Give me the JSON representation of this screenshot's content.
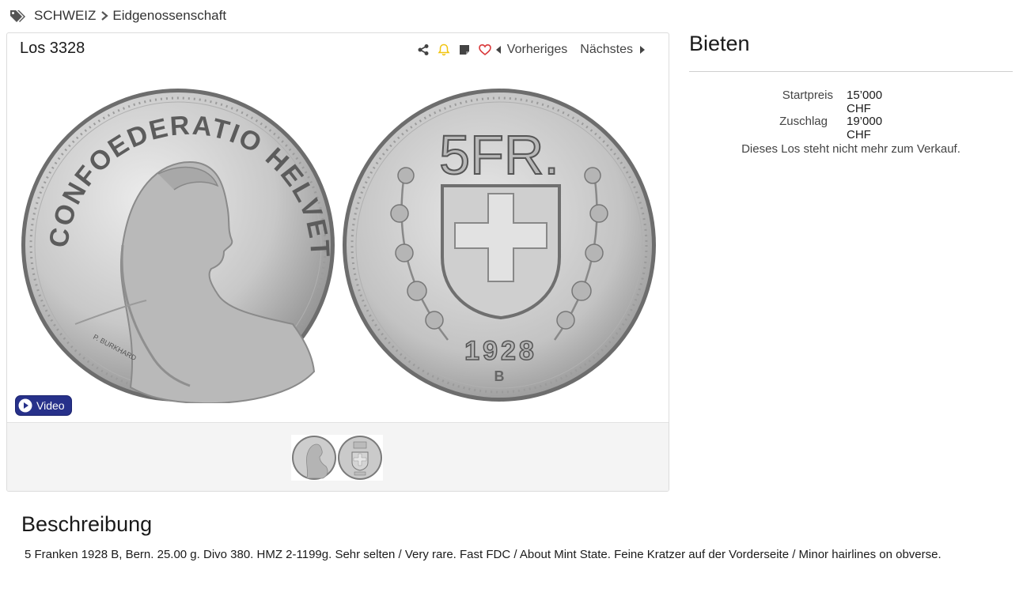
{
  "breadcrumb": {
    "tag_icon": "tags-icon",
    "items": [
      "SCHWEIZ",
      "Eidgenossenschaft"
    ]
  },
  "lot": {
    "title": "Los 3328",
    "toolbar": {
      "icons": [
        "share-icon",
        "bell-icon",
        "note-icon",
        "heart-icon"
      ],
      "prev_label": "Vorheriges",
      "next_label": "Nächstes"
    },
    "video_label": "Video",
    "coin": {
      "obverse_legend": "CONFOEDERATIO HELVETICA",
      "engraver": "P. BURKHARD",
      "denomination": "5FR.",
      "year": "1928",
      "mint_mark": "B"
    }
  },
  "bid": {
    "title": "Bieten",
    "start_label": "Startpreis",
    "start_value": "15’000 CHF",
    "hammer_label": "Zuschlag",
    "hammer_value": "19’000 CHF",
    "note": "Dieses Los steht nicht mehr zum Verkauf."
  },
  "description": {
    "title": "Beschreibung",
    "text": "5 Franken 1928 B, Bern. 25.00 g. Divo 380. HMZ 2-1199g. Sehr selten / Very rare. Fast FDC / About Mint State. Feine Kratzer auf der Vorderseite / Minor hairlines on obverse."
  },
  "colors": {
    "accent_blue": "#27318a",
    "bell": "#f1c40f",
    "heart": "#d9383a",
    "coin_silver": "#c9c9c9"
  }
}
